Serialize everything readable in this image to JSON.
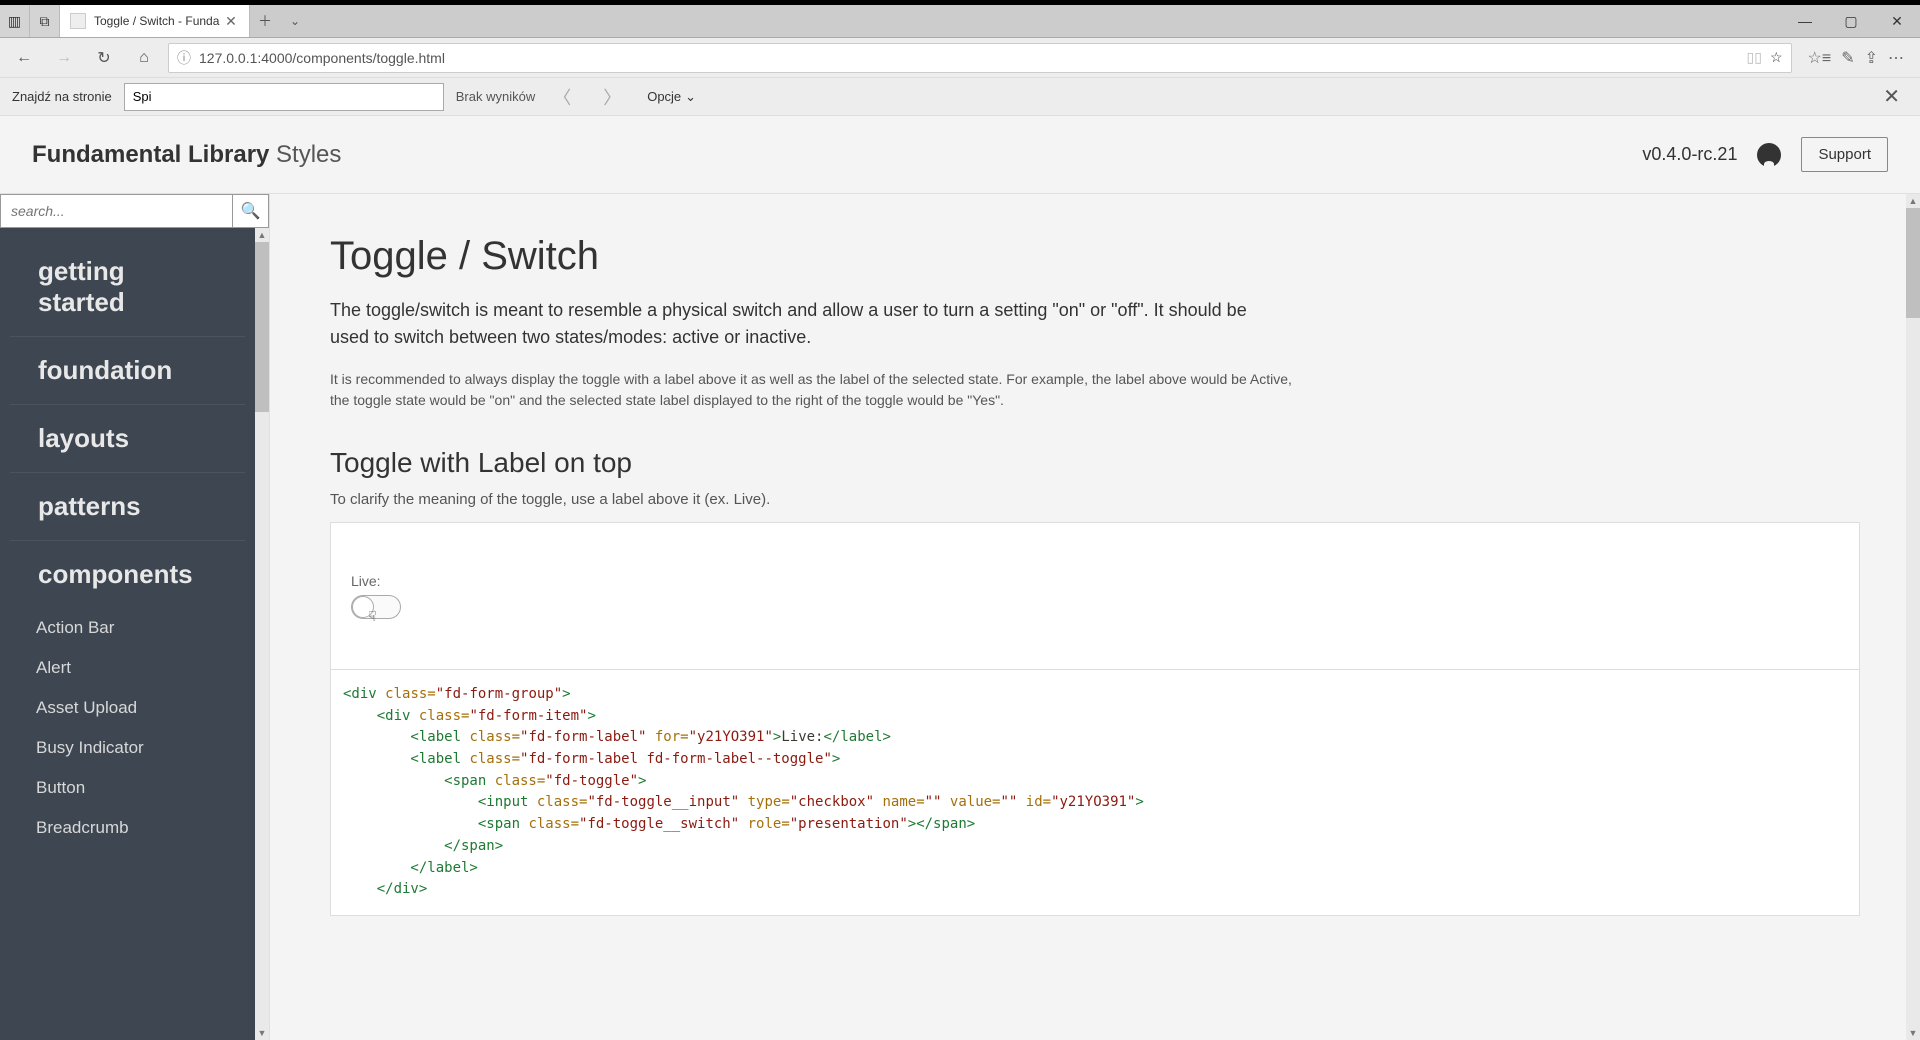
{
  "browser": {
    "tab_title": "Toggle / Switch - Funda",
    "url": "127.0.0.1:4000/components/toggle.html"
  },
  "find": {
    "label": "Znajdź na stronie",
    "value": "Spi",
    "result": "Brak wyników",
    "options": "Opcje"
  },
  "header": {
    "brand_bold": "Fundamental Library",
    "brand_light": "Styles",
    "version": "v0.4.0-rc.21",
    "support": "Support"
  },
  "sidebar": {
    "search_placeholder": "search...",
    "main": [
      "getting started",
      "foundation",
      "layouts",
      "patterns",
      "components"
    ],
    "subs": [
      "Action Bar",
      "Alert",
      "Asset Upload",
      "Busy Indicator",
      "Button",
      "Breadcrumb"
    ]
  },
  "content": {
    "title": "Toggle / Switch",
    "intro": "The toggle/switch is meant to resemble a physical switch and allow a user to turn a setting \"on\" or \"off\". It should be used to switch between two states/modes: active or inactive.",
    "detail": "It is recommended to always display the toggle with a label above it as well as the label of the selected state. For example, the label above would be Active, the toggle state would be \"on\" and the selected state label displayed to the right of the toggle would be \"Yes\".",
    "section_title": "Toggle with Label on top",
    "section_desc": "To clarify the meaning of the toggle, use a label above it (ex. Live).",
    "example_label": "Live:"
  },
  "code": {
    "l1a": "<div ",
    "l1b": "class=",
    "l1c": "\"fd-form-group\"",
    "l1d": ">",
    "l2a": "    <div ",
    "l2b": "class=",
    "l2c": "\"fd-form-item\"",
    "l2d": ">",
    "l3a": "        <label ",
    "l3b": "class=",
    "l3c": "\"fd-form-label\"",
    "l3d": " for=",
    "l3e": "\"y21YO391\"",
    "l3f": ">",
    "l3g": "Live:",
    "l3h": "</label>",
    "l4a": "        <label ",
    "l4b": "class=",
    "l4c": "\"fd-form-label fd-form-label--toggle\"",
    "l4d": ">",
    "l5a": "            <span ",
    "l5b": "class=",
    "l5c": "\"fd-toggle\"",
    "l5d": ">",
    "l6a": "                <input ",
    "l6b": "class=",
    "l6c": "\"fd-toggle__input\"",
    "l6d": " type=",
    "l6e": "\"checkbox\"",
    "l6f": " name=",
    "l6g": "\"\"",
    "l6h": " value=",
    "l6i": "\"\"",
    "l6j": " id=",
    "l6k": "\"y21YO391\"",
    "l6l": ">",
    "l7a": "                <span ",
    "l7b": "class=",
    "l7c": "\"fd-toggle__switch\"",
    "l7d": " role=",
    "l7e": "\"presentation\"",
    "l7f": ">",
    "l7g": "</span>",
    "l8a": "            </span>",
    "l9a": "        </label>",
    "l10a": "    </div>"
  }
}
